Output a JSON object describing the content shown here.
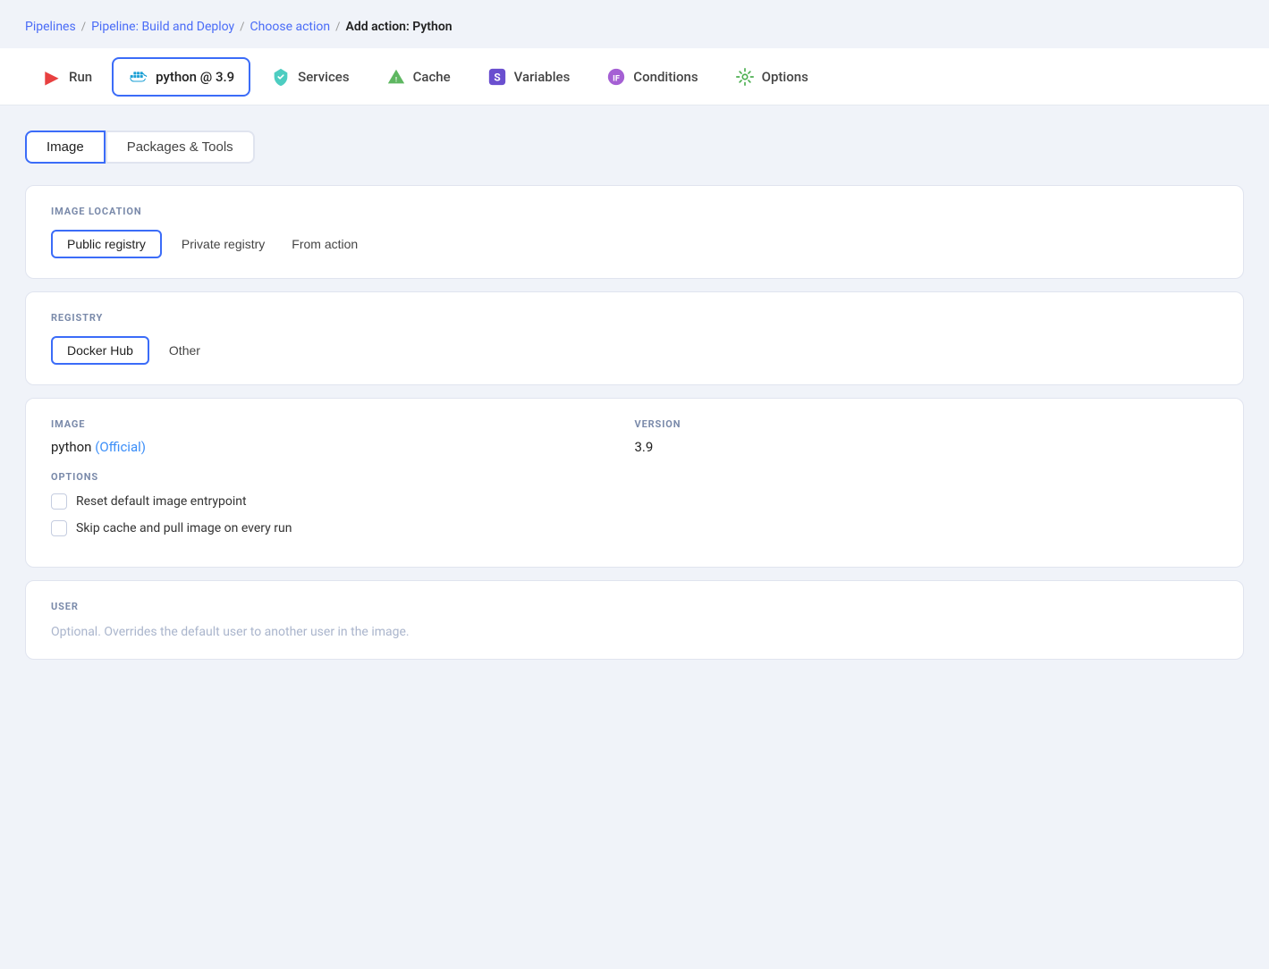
{
  "breadcrumb": {
    "items": [
      {
        "label": "Pipelines",
        "link": true
      },
      {
        "label": "Pipeline: Build and Deploy",
        "link": true
      },
      {
        "label": "Choose action",
        "link": true
      },
      {
        "label": "Add action: Python",
        "link": false
      }
    ],
    "separators": [
      "/",
      "/",
      "/"
    ]
  },
  "top_tabs": [
    {
      "id": "run",
      "label": "Run",
      "icon": "▶",
      "icon_name": "run-icon",
      "active": false
    },
    {
      "id": "python",
      "label": "python @ 3.9",
      "icon": "🐳",
      "icon_name": "docker-icon",
      "active": true
    },
    {
      "id": "services",
      "label": "Services",
      "icon": "🧳",
      "icon_name": "services-icon",
      "active": false
    },
    {
      "id": "cache",
      "label": "Cache",
      "icon": "🔺",
      "icon_name": "cache-icon",
      "active": false
    },
    {
      "id": "variables",
      "label": "Variables",
      "icon": "🟪",
      "icon_name": "variables-icon",
      "active": false
    },
    {
      "id": "conditions",
      "label": "Conditions",
      "icon": "🔮",
      "icon_name": "conditions-icon",
      "active": false
    },
    {
      "id": "options",
      "label": "Options",
      "icon": "⚙",
      "icon_name": "options-icon",
      "active": false
    }
  ],
  "sub_tabs": [
    {
      "id": "image",
      "label": "Image",
      "active": true
    },
    {
      "id": "packages_tools",
      "label": "Packages & Tools",
      "active": false
    }
  ],
  "image_location": {
    "label": "IMAGE LOCATION",
    "options": [
      {
        "id": "public",
        "label": "Public registry",
        "active": true
      },
      {
        "id": "private",
        "label": "Private registry",
        "active": false
      },
      {
        "id": "from_action",
        "label": "From action",
        "active": false
      }
    ]
  },
  "registry": {
    "label": "REGISTRY",
    "options": [
      {
        "id": "docker_hub",
        "label": "Docker Hub",
        "active": true
      },
      {
        "id": "other",
        "label": "Other",
        "active": false
      }
    ]
  },
  "image_section": {
    "image_label": "IMAGE",
    "version_label": "VERSION",
    "image_value": "python",
    "image_official": "(Official)",
    "version_value": "3.9",
    "options_label": "OPTIONS",
    "checkboxes": [
      {
        "id": "reset_entrypoint",
        "label": "Reset default image entrypoint",
        "checked": false
      },
      {
        "id": "skip_cache",
        "label": "Skip cache and pull image on every run",
        "checked": false
      }
    ]
  },
  "user_section": {
    "label": "USER",
    "placeholder": "Optional. Overrides the default user to another user in the image."
  }
}
